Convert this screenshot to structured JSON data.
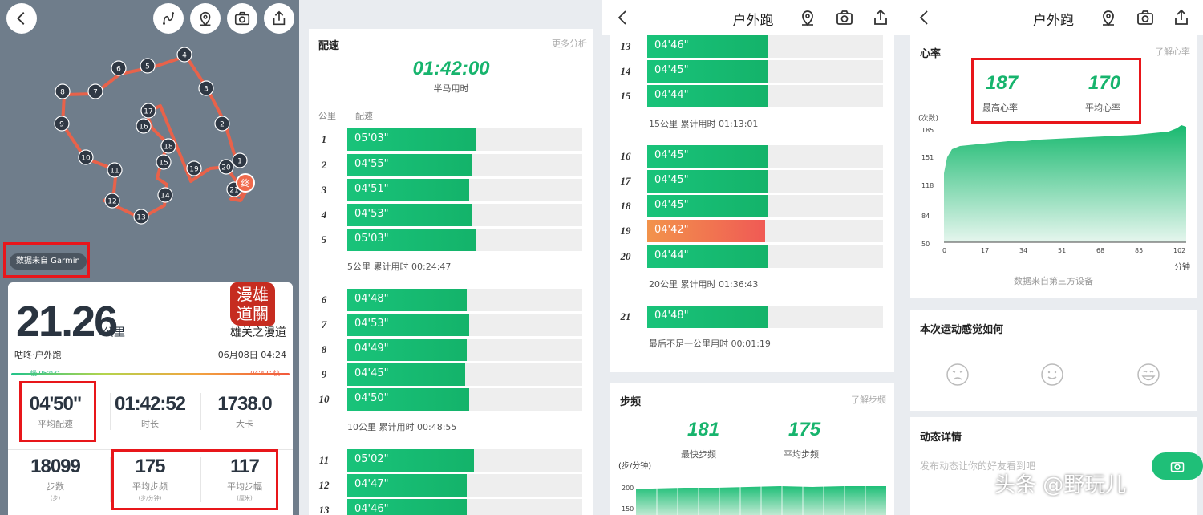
{
  "panel1": {
    "garmin_label": "数据来自 Garmin",
    "map_markers": [
      "1",
      "2",
      "3",
      "4",
      "5",
      "6",
      "7",
      "8",
      "9",
      "10",
      "11",
      "12",
      "13",
      "14",
      "15",
      "16",
      "17",
      "18",
      "19",
      "20",
      "21"
    ],
    "end_marker": "终",
    "distance": "21.26",
    "distance_unit": "公里",
    "seal_text": "漫雄道關",
    "author": "雄关之漫道",
    "sport": "咕咚·户外跑",
    "date": "06月08日 04:24",
    "slow_label": "慢 05'03\"",
    "fast_label": "04'42\" 快",
    "stats": [
      {
        "value": "04'50\"",
        "label": "平均配速"
      },
      {
        "value": "01:42:52",
        "label": "时长"
      },
      {
        "value": "1738.0",
        "label": "大卡"
      },
      {
        "value": "18099",
        "label": "步数",
        "unit": "(步)"
      },
      {
        "value": "175",
        "label": "平均步频",
        "unit": "(步/分钟)"
      },
      {
        "value": "117",
        "label": "平均步幅",
        "unit": "(厘米)"
      }
    ]
  },
  "panel2": {
    "section_title": "配速",
    "more_link": "更多分析",
    "half_time": "01:42:00",
    "half_label": "半马用时",
    "col_km": "公里",
    "col_pace": "配速",
    "rows": [
      {
        "km": "1",
        "pace": "05'03\"",
        "frac": 0.55
      },
      {
        "km": "2",
        "pace": "04'55\"",
        "frac": 0.53
      },
      {
        "km": "3",
        "pace": "04'51\"",
        "frac": 0.52
      },
      {
        "km": "4",
        "pace": "04'53\"",
        "frac": 0.53
      },
      {
        "km": "5",
        "pace": "05'03\"",
        "frac": 0.55
      },
      {
        "km": "6",
        "pace": "04'48\"",
        "frac": 0.51
      },
      {
        "km": "7",
        "pace": "04'53\"",
        "frac": 0.52
      },
      {
        "km": "8",
        "pace": "04'49\"",
        "frac": 0.51
      },
      {
        "km": "9",
        "pace": "04'45\"",
        "frac": 0.5
      },
      {
        "km": "10",
        "pace": "04'50\"",
        "frac": 0.52
      },
      {
        "km": "11",
        "pace": "05'02\"",
        "frac": 0.54
      },
      {
        "km": "12",
        "pace": "04'47\"",
        "frac": 0.51
      },
      {
        "km": "13",
        "pace": "04'46\"",
        "frac": 0.51
      }
    ],
    "cum5": "5公里  累计用时 00:24:47",
    "cum10": "10公里  累计用时 00:48:55"
  },
  "panel3": {
    "title": "户外跑",
    "rows": [
      {
        "km": "13",
        "pace": "04'46\"",
        "frac": 0.51
      },
      {
        "km": "14",
        "pace": "04'45\"",
        "frac": 0.51
      },
      {
        "km": "15",
        "pace": "04'44\"",
        "frac": 0.51
      },
      {
        "km": "16",
        "pace": "04'45\"",
        "frac": 0.51
      },
      {
        "km": "17",
        "pace": "04'45\"",
        "frac": 0.51
      },
      {
        "km": "18",
        "pace": "04'45\"",
        "frac": 0.51
      },
      {
        "km": "19",
        "pace": "04'42\"",
        "frac": 0.5,
        "fastest": true
      },
      {
        "km": "20",
        "pace": "04'44\"",
        "frac": 0.51
      },
      {
        "km": "21",
        "pace": "04'48\"",
        "frac": 0.51
      }
    ],
    "cum15": "15公里  累计用时 01:13:01",
    "cum20": "20公里  累计用时 01:36:43",
    "cum_last": "最后不足一公里用时 00:01:19",
    "cadence_title": "步频",
    "cadence_link": "了解步频",
    "max_cadence": "181",
    "max_cadence_label": "最快步频",
    "avg_cadence": "175",
    "avg_cadence_label": "平均步频",
    "cadence_unit": "(步/分钟)",
    "cadence_ticks": [
      "200",
      "150"
    ]
  },
  "panel4": {
    "title": "户外跑",
    "hr_title": "心率",
    "hr_link": "了解心率",
    "max_hr": "187",
    "max_hr_label": "最高心率",
    "avg_hr": "170",
    "avg_hr_label": "平均心率",
    "hr_unit": "(次数)",
    "y_ticks": [
      "185",
      "151",
      "118",
      "84",
      "50"
    ],
    "x_ticks": [
      "0",
      "17",
      "34",
      "51",
      "68",
      "85",
      "102"
    ],
    "x_unit": "分钟",
    "source": "数据来自第三方设备",
    "feel_title": "本次运动感觉如何",
    "post_title": "动态详情",
    "post_placeholder": "发布动态让你的好友看到吧"
  },
  "watermark": "头条 @野玩儿",
  "colors": {
    "green": "#17b46d",
    "red_box": "#e8161a",
    "fast_bar": "#f05a55"
  }
}
